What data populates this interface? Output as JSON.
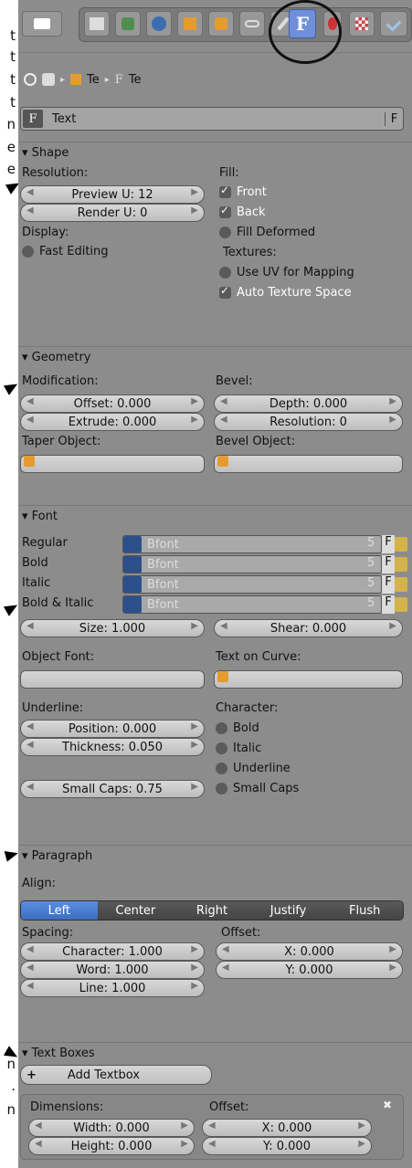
{
  "left_margin_text": {
    "lines": [
      "t",
      "t",
      "t",
      "t",
      "n",
      "e",
      "e"
    ],
    "bottom": [
      "n",
      ".",
      "n"
    ]
  },
  "toolbar": {
    "active_button_label": "F",
    "icons": [
      "editor-type-icon",
      "render-icon",
      "scene-icon",
      "world-icon",
      "object-icon",
      "constraint-icon",
      "modifier-icon",
      "data-font-icon",
      "material-icon",
      "texture-icon",
      "physics-icon"
    ]
  },
  "breadcrumb": {
    "item1": "Te",
    "item2": "Te"
  },
  "name_field": {
    "value": "Text",
    "fake_user": "F"
  },
  "shape": {
    "title": "Shape",
    "resolution_label": "Resolution:",
    "preview_u": "Preview U: 12",
    "render_u": "Render U: 0",
    "display_label": "Display:",
    "fast_editing": "Fast Editing",
    "fill_label": "Fill:",
    "front": "Front",
    "back": "Back",
    "fill_deformed": "Fill Deformed",
    "textures_label": "Textures:",
    "use_uv": "Use UV for Mapping",
    "auto_texture": "Auto Texture Space"
  },
  "geometry": {
    "title": "Geometry",
    "modification_label": "Modification:",
    "offset": "Offset: 0.000",
    "extrude": "Extrude: 0.000",
    "taper_label": "Taper Object:",
    "bevel_label": "Bevel:",
    "depth": "Depth: 0.000",
    "resolution": "Resolution: 0",
    "bevel_object_label": "Bevel Object:"
  },
  "font": {
    "title": "Font",
    "rows": [
      {
        "label": "Regular",
        "value": "Bfont",
        "users": "5",
        "f": "F"
      },
      {
        "label": "Bold",
        "value": "Bfont",
        "users": "5",
        "f": "F"
      },
      {
        "label": "Italic",
        "value": "Bfont",
        "users": "5",
        "f": "F"
      },
      {
        "label": "Bold & Italic",
        "value": "Bfont",
        "users": "5",
        "f": "F"
      }
    ],
    "size": "Size: 1.000",
    "shear": "Shear: 0.000",
    "object_font_label": "Object Font:",
    "text_on_curve_label": "Text on Curve:",
    "underline_label": "Underline:",
    "position": "Position: 0.000",
    "thickness": "Thickness: 0.050",
    "character_label": "Character:",
    "bold": "Bold",
    "italic": "Italic",
    "underline": "Underline",
    "small_caps": "Small Caps",
    "small_caps_value": "Small Caps: 0.75"
  },
  "paragraph": {
    "title": "Paragraph",
    "align_label": "Align:",
    "align_options": [
      "Left",
      "Center",
      "Right",
      "Justify",
      "Flush"
    ],
    "spacing_label": "Spacing:",
    "character": "Character: 1.000",
    "word": "Word: 1.000",
    "line": "Line: 1.000",
    "offset_label": "Offset:",
    "x": "X: 0.000",
    "y": "Y: 0.000"
  },
  "text_boxes": {
    "title": "Text Boxes",
    "add_textbox": "Add Textbox",
    "dimensions_label": "Dimensions:",
    "width": "Width: 0.000",
    "height": "Height: 0.000",
    "offset_label": "Offset:",
    "x": "X: 0.000",
    "y": "Y: 0.000"
  },
  "colors": {
    "panel_bg": "#8c8c8c",
    "active_blue": "#4a7ed0"
  }
}
